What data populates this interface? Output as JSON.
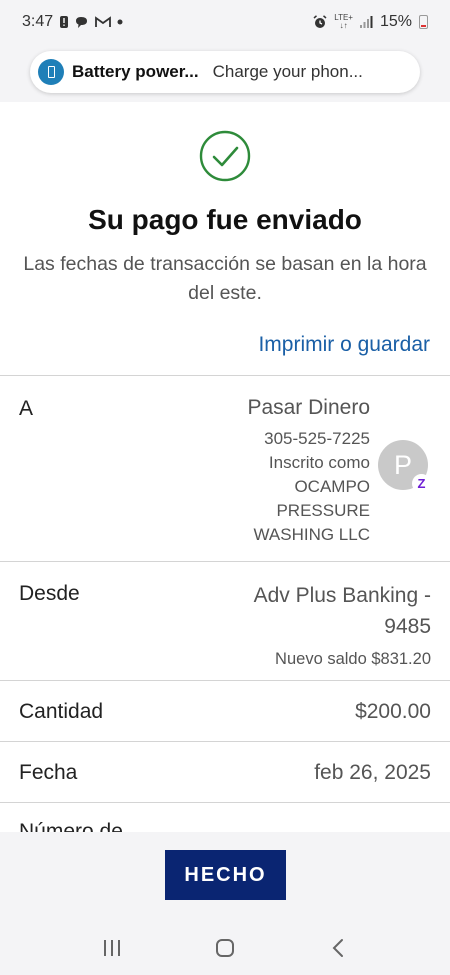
{
  "status_bar": {
    "time": "3:47",
    "network": "LTE+",
    "battery": "15%"
  },
  "notification": {
    "title": "Battery power...",
    "body": "Charge your phon..."
  },
  "confirmation": {
    "title": "Su pago fue enviado",
    "subtitle": "Las fechas de transacción se basan en la hora del este.",
    "print_link": "Imprimir o guardar"
  },
  "details": {
    "to": {
      "label": "A",
      "name": "Pasar Dinero",
      "phone": "305-525-7225",
      "enrolled_as": "Inscrito como",
      "company_line1": "OCAMPO",
      "company_line2": "PRESSURE",
      "company_line3": "WASHING LLC",
      "avatar_initial": "P",
      "badge": "Z"
    },
    "from": {
      "label": "Desde",
      "account_line1": "Adv Plus Banking -",
      "account_line2": "9485",
      "new_balance": "Nuevo saldo $831.20"
    },
    "amount": {
      "label": "Cantidad",
      "value": "$200.00"
    },
    "date": {
      "label": "Fecha",
      "value": "feb 26, 2025"
    },
    "partial_label": "Número de"
  },
  "done_button": "HECHO",
  "icons": {
    "check": "check-circle-icon",
    "battery_notification": "battery-icon",
    "nav_recent": "recent-apps-icon",
    "nav_home": "home-icon",
    "nav_back": "back-icon"
  },
  "colors": {
    "accent": "#1a5fa6",
    "button": "#0a2572",
    "success": "#2e8b3a",
    "zelle": "#6d1ed4"
  }
}
